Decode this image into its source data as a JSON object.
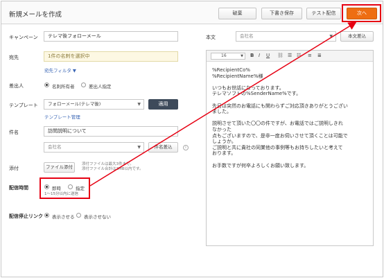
{
  "header": {
    "title": "新規メールを作成",
    "cancel_label": "破棄",
    "draft_label": "下書き保存",
    "test_label": "テスト配信",
    "next_label": "次へ"
  },
  "form": {
    "campaign": {
      "label": "キャンペーン",
      "value": "テレマ後フォローメール"
    },
    "destination": {
      "label": "宛先",
      "value": "1件の名刺を選択中",
      "filter_link": "宛先フィルタ ▼"
    },
    "sender": {
      "label": "差出人",
      "option1": "名刺所有者",
      "option2": "差出人指定"
    },
    "template": {
      "label": "テンプレート",
      "value": "フォローメール(テレマ後)",
      "apply_label": "適用",
      "manage_link": "テンプレート管理"
    },
    "subject": {
      "label": "件名",
      "value": "訪問説明について",
      "insert_placeholder": "会社名",
      "insert_button": "件名差込",
      "info_icon": "i"
    },
    "attachment": {
      "label": "添付",
      "button": "ファイル添付",
      "note_line1": "添付ファイルは最大3件まで。",
      "note_line2": "添付ファイル合計は3MB以内です。"
    },
    "send_time": {
      "label": "配信時間",
      "option1": "即時",
      "option2": "指定",
      "note": "1～15分以内に送信"
    },
    "open_track": {
      "label": "配信停止リンク",
      "option1": "表示させる",
      "option2": "表示させない"
    }
  },
  "body": {
    "label": "本文",
    "insert_placeholder": "会社名",
    "insert_button": "本文差込",
    "font_size": "16",
    "toolbar": {
      "bold": "B",
      "italic": "I",
      "underline": "U",
      "link": "⛓",
      "ol": "☰",
      "ul": "☷",
      "align_left": "≡",
      "align_center": "≣"
    },
    "lines": [
      "%RecipientCo%",
      "%RecipientName%様",
      "",
      "いつもお世話になっております。",
      "テレマソフトの%SenderName%です。",
      "",
      "先日は突然のお電話にも関わらずご対応頂きありがとうござい",
      "ました。",
      "",
      "説明させて頂いた〇〇の件ですが、お電話ではご説明しきれ",
      "なかった",
      "点もございますので、是非一度お伺いさせて頂くことは可能で",
      "しょうか。",
      "ご説明と共に貴社の同業他の事例等もお持ちしたいと考えて",
      "おります。",
      "",
      "お手数ですが何卒よろしくお願い致します。"
    ]
  },
  "colors": {
    "accent_next": "#ee6e12",
    "highlight": "#e60012",
    "dark_button": "#3d4a5a",
    "link": "#3a66b5"
  }
}
